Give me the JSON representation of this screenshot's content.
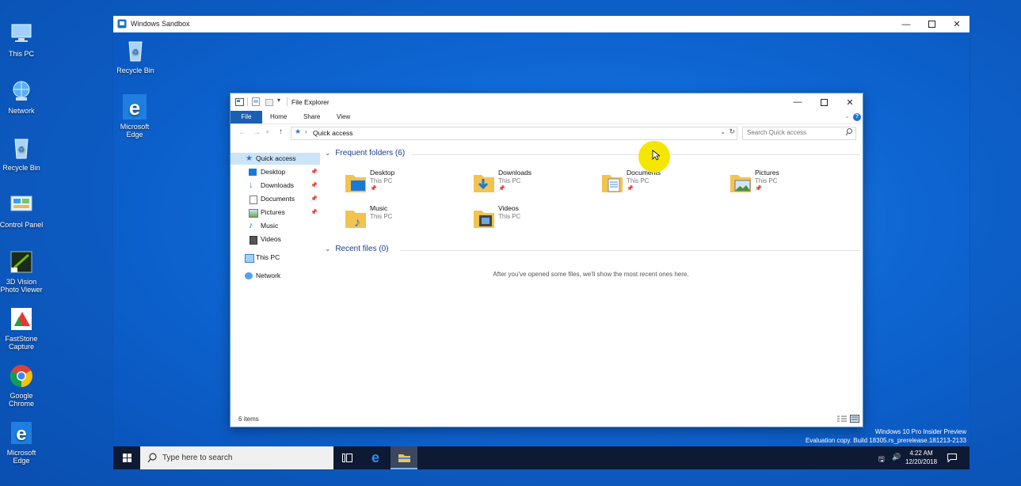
{
  "host_desktop": {
    "icons": [
      {
        "label": "This PC",
        "icon": "this-pc-icon"
      },
      {
        "label": "Network",
        "icon": "network-icon"
      },
      {
        "label": "Recycle Bin",
        "icon": "recycle-bin-icon"
      },
      {
        "label": "Control Panel",
        "icon": "control-panel-icon"
      },
      {
        "label": "3D Vision Photo Viewer",
        "icon": "3d-vision-icon"
      },
      {
        "label": "FastStone Capture",
        "icon": "faststone-icon"
      },
      {
        "label": "Google Chrome",
        "icon": "chrome-icon"
      },
      {
        "label": "Microsoft Edge",
        "icon": "edge-icon"
      }
    ]
  },
  "sandbox": {
    "title": "Windows Sandbox",
    "desktop_icons": [
      {
        "label": "Recycle Bin",
        "icon": "recycle-bin-icon"
      },
      {
        "label": "Microsoft Edge",
        "icon": "edge-icon"
      }
    ],
    "watermark": {
      "line1": "Windows 10 Pro Insider Preview",
      "line2": "Evaluation copy. Build 18305.rs_prerelease.181213-2133"
    },
    "taskbar": {
      "search_placeholder": "Type here to search",
      "time": "4:22 AM",
      "date": "12/20/2018"
    }
  },
  "explorer": {
    "title": "File Explorer",
    "ribbon_tabs": [
      "File",
      "Home",
      "Share",
      "View"
    ],
    "address": "Quick access",
    "search_placeholder": "Search Quick access",
    "nav": {
      "quick_access": "Quick access",
      "pinned": [
        "Desktop",
        "Downloads",
        "Documents",
        "Pictures"
      ],
      "unpinned": [
        "Music",
        "Videos"
      ],
      "this_pc": "This PC",
      "network": "Network"
    },
    "frequent_header": "Frequent folders (6)",
    "folders": [
      {
        "name": "Desktop",
        "location": "This PC",
        "pinned": true
      },
      {
        "name": "Downloads",
        "location": "This PC",
        "pinned": true
      },
      {
        "name": "Documents",
        "location": "This PC",
        "pinned": true
      },
      {
        "name": "Pictures",
        "location": "This PC",
        "pinned": true
      },
      {
        "name": "Music",
        "location": "This PC",
        "pinned": false
      },
      {
        "name": "Videos",
        "location": "This PC",
        "pinned": false
      }
    ],
    "recent_header": "Recent files (0)",
    "recent_empty": "After you've opened some files, we'll show the most recent ones here.",
    "status": "6 items"
  },
  "colors": {
    "accent": "#1a5fb4",
    "cursor_highlight": "#f5e600",
    "folder": "#f3c350"
  }
}
